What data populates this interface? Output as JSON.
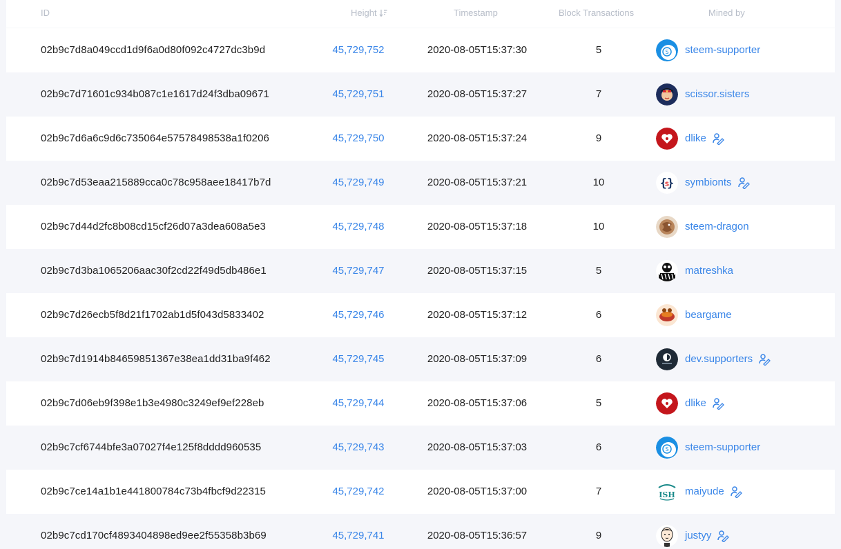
{
  "columns": {
    "id": "ID",
    "height": "Height",
    "timestamp": "Timestamp",
    "block_transactions": "Block Transactions",
    "mined_by": "Mined by"
  },
  "colors": {
    "link": "#3a86e8",
    "header_text": "#b7bdc8",
    "row_alt": "#f5f6fa"
  },
  "rows": [
    {
      "id": "02b9c7d8a049ccd1d9f6a0d80f092c4727dc3b9d",
      "height": "45,729,752",
      "timestamp": "2020-08-05T15:37:30",
      "transactions": "5",
      "miner": "steem-supporter",
      "avatar": "steem-supporter-avatar",
      "witness_icon": false
    },
    {
      "id": "02b9c7d71601c934b087c1e1617d24f3dba09671",
      "height": "45,729,751",
      "timestamp": "2020-08-05T15:37:27",
      "transactions": "7",
      "miner": "scissor.sisters",
      "avatar": "scissor-sisters-avatar",
      "witness_icon": false
    },
    {
      "id": "02b9c7d6a6c9d6c735064e57578498538a1f0206",
      "height": "45,729,750",
      "timestamp": "2020-08-05T15:37:24",
      "transactions": "9",
      "miner": "dlike",
      "avatar": "dlike-avatar",
      "witness_icon": true
    },
    {
      "id": "02b9c7d53eaa215889cca0c78c958aee18417b7d",
      "height": "45,729,749",
      "timestamp": "2020-08-05T15:37:21",
      "transactions": "10",
      "miner": "symbionts",
      "avatar": "symbionts-avatar",
      "witness_icon": true
    },
    {
      "id": "02b9c7d44d2fc8b08cd15cf26d07a3dea608a5e3",
      "height": "45,729,748",
      "timestamp": "2020-08-05T15:37:18",
      "transactions": "10",
      "miner": "steem-dragon",
      "avatar": "steem-dragon-avatar",
      "witness_icon": false
    },
    {
      "id": "02b9c7d3ba1065206aac30f2cd22f49d5db486e1",
      "height": "45,729,747",
      "timestamp": "2020-08-05T15:37:15",
      "transactions": "5",
      "miner": "matreshka",
      "avatar": "matreshka-avatar",
      "witness_icon": false
    },
    {
      "id": "02b9c7d26ecb5f8d21f1702ab1d5f043d5833402",
      "height": "45,729,746",
      "timestamp": "2020-08-05T15:37:12",
      "transactions": "6",
      "miner": "beargame",
      "avatar": "beargame-avatar",
      "witness_icon": false
    },
    {
      "id": "02b9c7d1914b84659851367e38ea1dd31ba9f462",
      "height": "45,729,745",
      "timestamp": "2020-08-05T15:37:09",
      "transactions": "6",
      "miner": "dev.supporters",
      "avatar": "dev-supporters-avatar",
      "witness_icon": true
    },
    {
      "id": "02b9c7d06eb9f398e1b3e4980c3249ef9ef228eb",
      "height": "45,729,744",
      "timestamp": "2020-08-05T15:37:06",
      "transactions": "5",
      "miner": "dlike",
      "avatar": "dlike-avatar",
      "witness_icon": true
    },
    {
      "id": "02b9c7cf6744bfe3a07027f4e125f8dddd960535",
      "height": "45,729,743",
      "timestamp": "2020-08-05T15:37:03",
      "transactions": "6",
      "miner": "steem-supporter",
      "avatar": "steem-supporter-avatar",
      "witness_icon": false
    },
    {
      "id": "02b9c7ce14a1b1e441800784c73b4fbcf9d22315",
      "height": "45,729,742",
      "timestamp": "2020-08-05T15:37:00",
      "transactions": "7",
      "miner": "maiyude",
      "avatar": "maiyude-avatar",
      "witness_icon": true
    },
    {
      "id": "02b9c7cd170cf4893404898ed9ee2f55358b3b69",
      "height": "45,729,741",
      "timestamp": "2020-08-05T15:36:57",
      "transactions": "9",
      "miner": "justyy",
      "avatar": "justyy-avatar",
      "witness_icon": true
    }
  ]
}
